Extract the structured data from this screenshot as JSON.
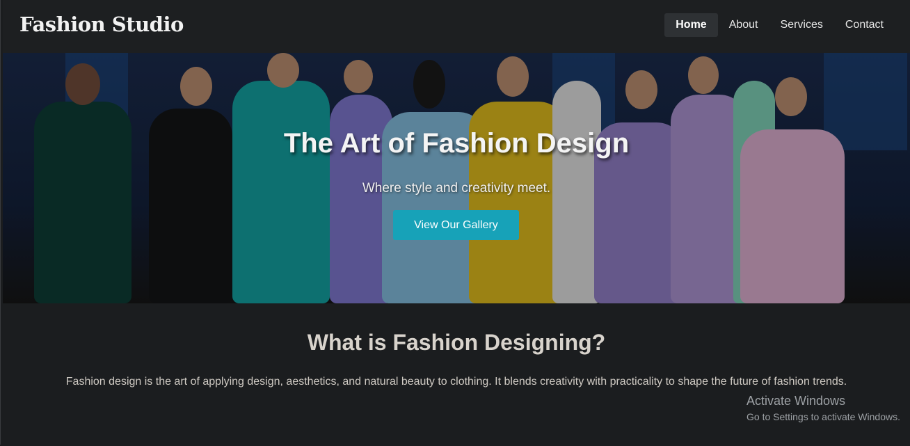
{
  "navbar": {
    "brand": "Fashion Studio",
    "items": [
      {
        "label": "Home",
        "active": true
      },
      {
        "label": "About",
        "active": false
      },
      {
        "label": "Services",
        "active": false
      },
      {
        "label": "Contact",
        "active": false
      }
    ]
  },
  "hero": {
    "title": "The Art of Fashion Design",
    "subtitle": "Where style and creativity meet.",
    "button_label": "View Our Gallery",
    "accent_color": "#17a2b8"
  },
  "about": {
    "heading": "What is Fashion Designing?",
    "text": "Fashion design is the art of applying design, aesthetics, and natural beauty to clothing. It blends creativity with practicality to shape the future of fashion trends."
  },
  "watermark": {
    "line1": "Activate Windows",
    "line2": "Go to Settings to activate Windows."
  }
}
